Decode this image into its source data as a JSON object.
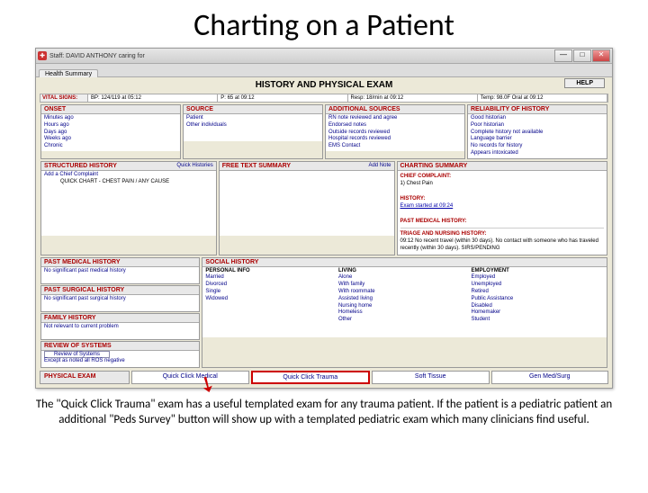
{
  "slide": {
    "title": "Charting on a Patient",
    "caption": "The \"Quick Click Trauma\" exam has a useful templated exam for any trauma patient. If the patient is a pediatric patient an additional \"Peds Survey\" button will show up with a templated pediatric exam which many clinicians find useful."
  },
  "window": {
    "titlebar": "Staff: DAVID ANTHONY caring for",
    "tab": "Health Summary",
    "main_title": "HISTORY AND PHYSICAL EXAM",
    "help": "HELP"
  },
  "vitals": {
    "label": "VITAL SIGNS:",
    "bp": "BP: 124/119 at 05:12",
    "pulse": "P: 65 at 09:12",
    "resp": "Resp: 18/min at 09:12",
    "temp": "Temp: 98.0F Oral at 09:12"
  },
  "onset": {
    "hdr": "ONSET",
    "items": [
      "Minutes ago",
      "Hours ago",
      "Days ago",
      "Weeks ago",
      "Chronic"
    ]
  },
  "source": {
    "hdr": "SOURCE",
    "items": [
      "Patient",
      "Other individuals"
    ]
  },
  "addl": {
    "hdr": "ADDITIONAL SOURCES",
    "items": [
      "RN note reviewed and agree",
      "Endorsed notes",
      "Outside records reviewed",
      "Hospital records reviewed",
      "EMS Contact"
    ]
  },
  "reliab": {
    "hdr": "RELIABILITY OF HISTORY",
    "items": [
      "Good historian",
      "Poor historian",
      "Complete history not available",
      "Language barrier",
      "No records for history",
      "Appears intoxicated"
    ]
  },
  "struct": {
    "hdr": "STRUCTURED HISTORY",
    "extra": "Quick Histories",
    "sub": "QUICK CHART - CHEST PAIN / ANY CAUSE",
    "add": "Add a Chief Complaint"
  },
  "freetext": {
    "hdr": "FREE TEXT SUMMARY",
    "extra": "Add Note"
  },
  "charting": {
    "hdr": "CHARTING SUMMARY",
    "cc_lbl": "CHIEF COMPLAINT:",
    "cc": "1) Chest Pain",
    "hist_lbl": "HISTORY:",
    "hist": "Exam started at 09:24",
    "pmh_lbl": "PAST MEDICAL HISTORY:",
    "tri_lbl": "TRIAGE AND NURSING HISTORY:",
    "tri": "09:12 No recent travel (within 30 days). No contact with someone who has traveled recently (within 30 days). SIRS/PENDING"
  },
  "pmh": {
    "hdr": "PAST MEDICAL HISTORY",
    "txt": "No significant past medical history"
  },
  "psh": {
    "hdr": "PAST SURGICAL HISTORY",
    "txt": "No significant past surgical history"
  },
  "fam": {
    "hdr": "FAMILY HISTORY",
    "txt": "Not relevant to current problem"
  },
  "ros": {
    "hdr": "REVIEW OF SYSTEMS",
    "btn": "Review of Systems",
    "txt": "Except as noted all ROS negative"
  },
  "social": {
    "hdr": "SOCIAL HISTORY",
    "pinfo": "PERSONAL INFO",
    "items": [
      "Married",
      "Divorced",
      "Single",
      "Widowed"
    ]
  },
  "living": {
    "hdr": "LIVING",
    "items": [
      "Alone",
      "With family",
      "With roommate",
      "Assisted living",
      "Nursing home",
      "Homeless",
      "Other"
    ]
  },
  "employ": {
    "hdr": "EMPLOYMENT",
    "items": [
      "Employed",
      "Unemployed",
      "Retired",
      "Public Assistance",
      "Disabled",
      "Homemaker",
      "Student"
    ]
  },
  "pe": {
    "hdr": "PHYSICAL EXAM",
    "b1": "Quick Click Medical",
    "b2": "Quick Click Trauma",
    "b3": "Soft Tissue",
    "b4": "Gen Med/Surg"
  }
}
